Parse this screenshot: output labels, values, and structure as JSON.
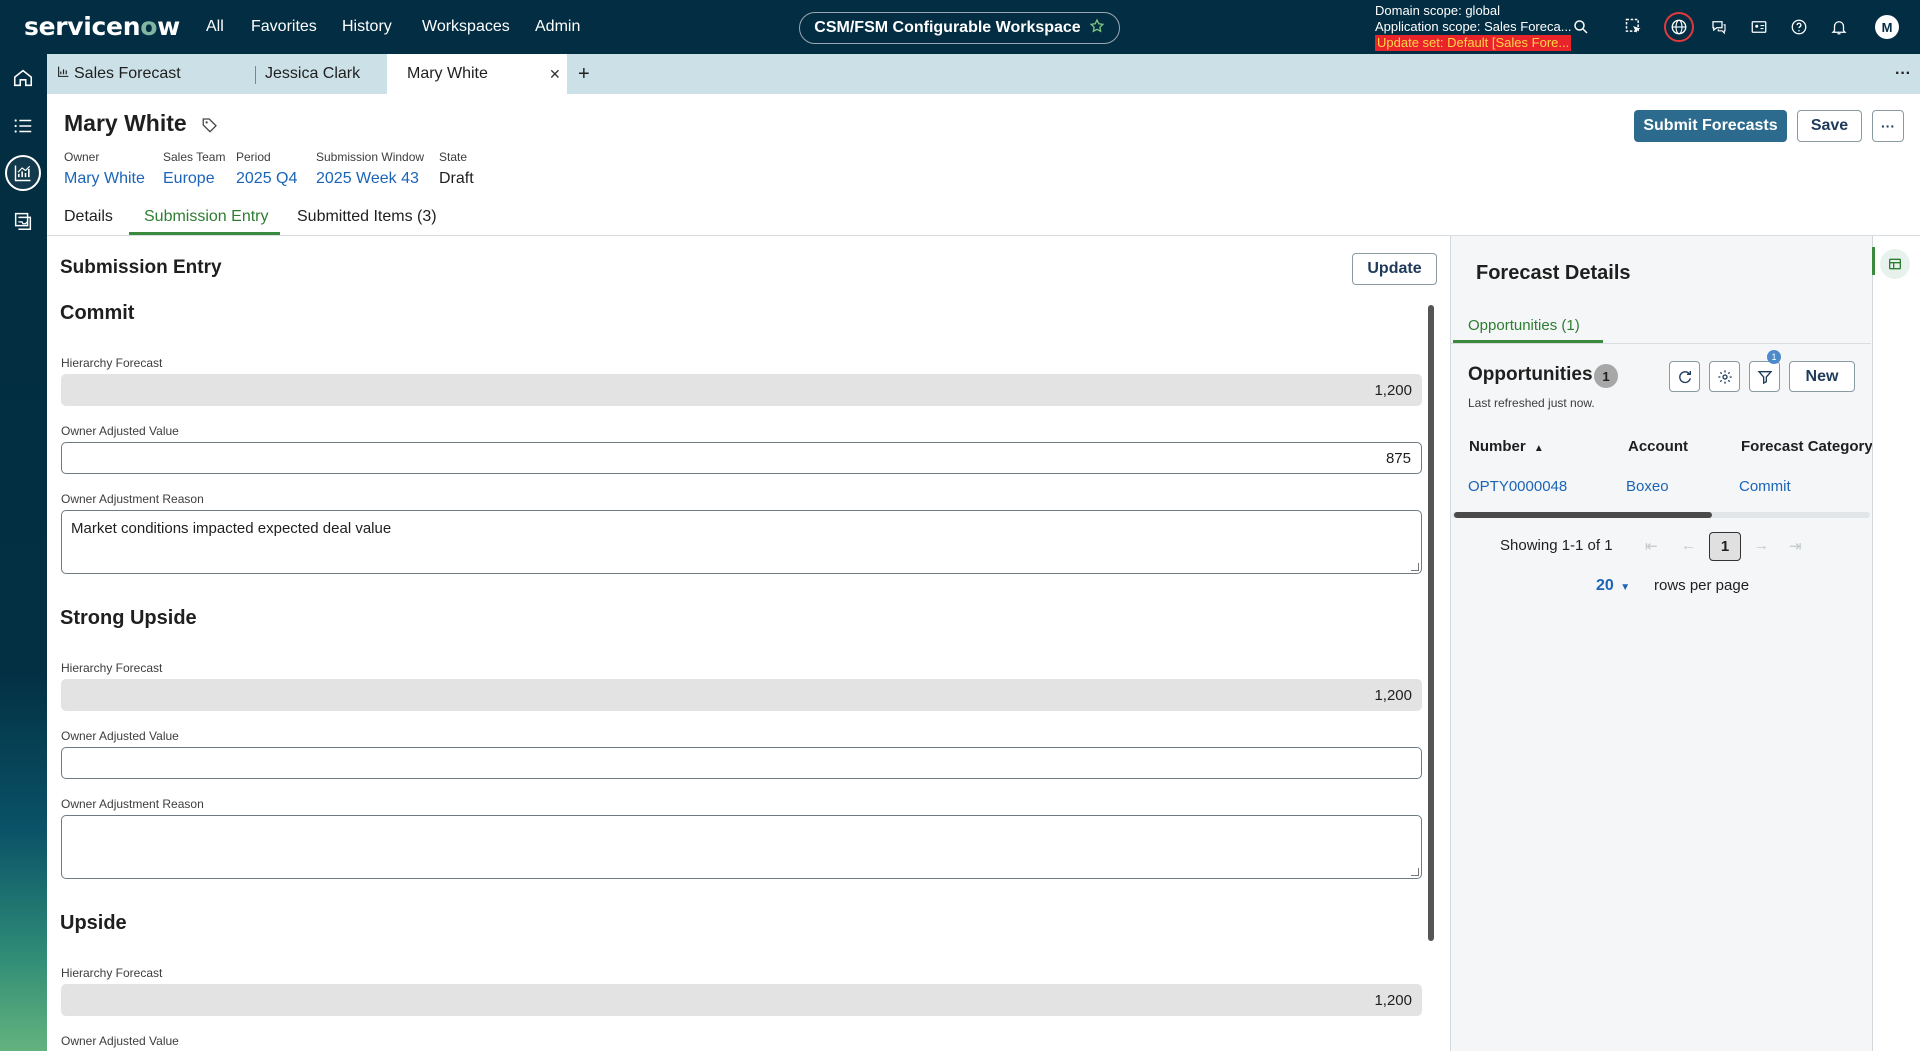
{
  "topnav": {
    "logo": "servicenow",
    "menu": [
      "All",
      "Favorites",
      "History",
      "Workspaces",
      "Admin"
    ],
    "workspace": "CSM/FSM Configurable Workspace",
    "scope_domain": "Domain scope: global",
    "scope_app": "Application scope: Sales Foreca...",
    "update_set": "Update set: Default [Sales Fore...",
    "avatar": "M"
  },
  "tabs": [
    {
      "label": "Sales Forecast"
    },
    {
      "label": "Jessica Clark"
    },
    {
      "label": "Mary White"
    }
  ],
  "record": {
    "title": "Mary White",
    "meta": [
      {
        "label": "Owner",
        "value": "Mary White"
      },
      {
        "label": "Sales Team",
        "value": "Europe"
      },
      {
        "label": "Period",
        "value": "2025 Q4"
      },
      {
        "label": "Submission Window",
        "value": "2025 Week 43"
      },
      {
        "label": "State",
        "value": "Draft"
      }
    ],
    "submit_label": "Submit Forecasts",
    "save_label": "Save",
    "more_label": "···"
  },
  "record_tabs": [
    "Details",
    "Submission Entry",
    "Submitted Items (3)"
  ],
  "entry": {
    "title": "Submission Entry",
    "update_label": "Update",
    "sections": [
      {
        "title": "Commit",
        "hf_label": "Hierarchy Forecast",
        "hf_value": "1,200",
        "oav_label": "Owner Adjusted Value",
        "oav_value": "875",
        "reason_label": "Owner Adjustment Reason",
        "reason_value": "Market conditions impacted expected deal value"
      },
      {
        "title": "Strong Upside",
        "hf_label": "Hierarchy Forecast",
        "hf_value": "1,200",
        "oav_label": "Owner Adjusted Value",
        "oav_value": "",
        "reason_label": "Owner Adjustment Reason",
        "reason_value": ""
      },
      {
        "title": "Upside",
        "hf_label": "Hierarchy Forecast",
        "hf_value": "1,200",
        "oav_label": "Owner Adjusted Value"
      }
    ]
  },
  "forecast_details": {
    "title": "Forecast Details",
    "tab": "Opportunities (1)",
    "list_title": "Opportunities",
    "count": "1",
    "refreshed": "Last refreshed just now.",
    "filter_badge": "1",
    "new_label": "New",
    "columns": [
      "Number",
      "Account",
      "Forecast Category"
    ],
    "sort_glyph": "▲",
    "rows": [
      {
        "number": "OPTY0000048",
        "account": "Boxeo",
        "category": "Commit"
      }
    ],
    "showing": "Showing 1-1 of 1",
    "page": "1",
    "rows_per_page": "20",
    "rows_per_page_label": "rows per page"
  },
  "colors": {
    "topnav": "#032d42",
    "accent_green": "#3b8a3e",
    "link_blue": "#1c64b7",
    "primary_button": "#2d6b8e"
  }
}
